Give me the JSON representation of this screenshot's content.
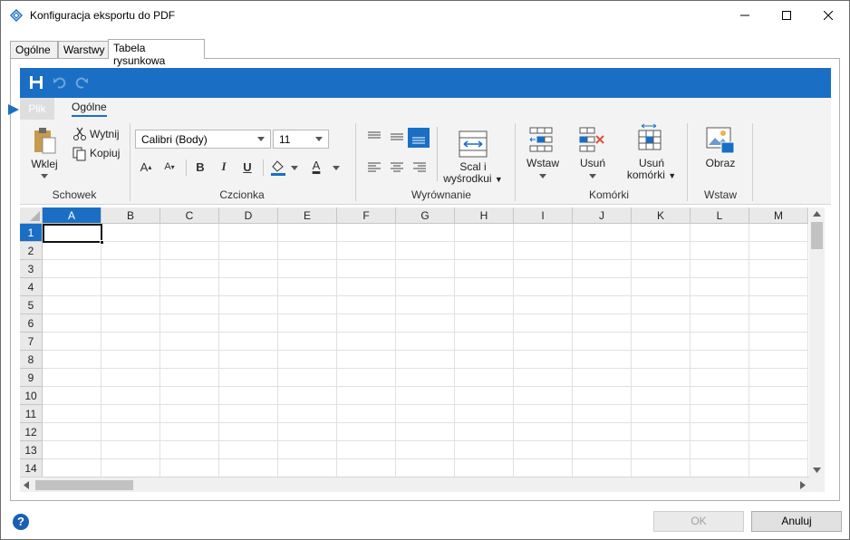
{
  "window": {
    "title": "Konfiguracja eksportu do PDF"
  },
  "tabs": [
    {
      "label": "Ogólne"
    },
    {
      "label": "Warstwy"
    },
    {
      "label": "Tabela rysunkowa"
    }
  ],
  "ribbon": {
    "file_tab": "Plik",
    "home_tab": "Ogólne",
    "clipboard": {
      "paste": "Wklej",
      "cut": "Wytnij",
      "copy": "Kopiuj",
      "group": "Schowek"
    },
    "font": {
      "family": "Calibri (Body)",
      "size": "11",
      "group": "Czcionka",
      "bold": "B",
      "italic": "I",
      "underline": "U",
      "font_color": "A"
    },
    "alignment": {
      "merge_line1": "Scal i",
      "merge_line2": "wyśrodkui",
      "group": "Wyrównanie"
    },
    "cells": {
      "insert": "Wstaw",
      "delete": "Usuń",
      "delete_cells_line1": "Usuń",
      "delete_cells_line2": "komórki",
      "group": "Komórki"
    },
    "insert": {
      "image": "Obraz",
      "group": "Wstaw"
    }
  },
  "sheet": {
    "columns": [
      "A",
      "B",
      "C",
      "D",
      "E",
      "F",
      "G",
      "H",
      "I",
      "J",
      "K",
      "L",
      "M"
    ],
    "rows": [
      "1",
      "2",
      "3",
      "4",
      "5",
      "6",
      "7",
      "8",
      "9",
      "10",
      "11",
      "12",
      "13",
      "14"
    ],
    "active_cell": "A1"
  },
  "footer": {
    "ok": "OK",
    "cancel": "Anuluj",
    "help": "?"
  },
  "colors": {
    "accent": "#1a6fc4",
    "help": "#1a5fb4"
  }
}
